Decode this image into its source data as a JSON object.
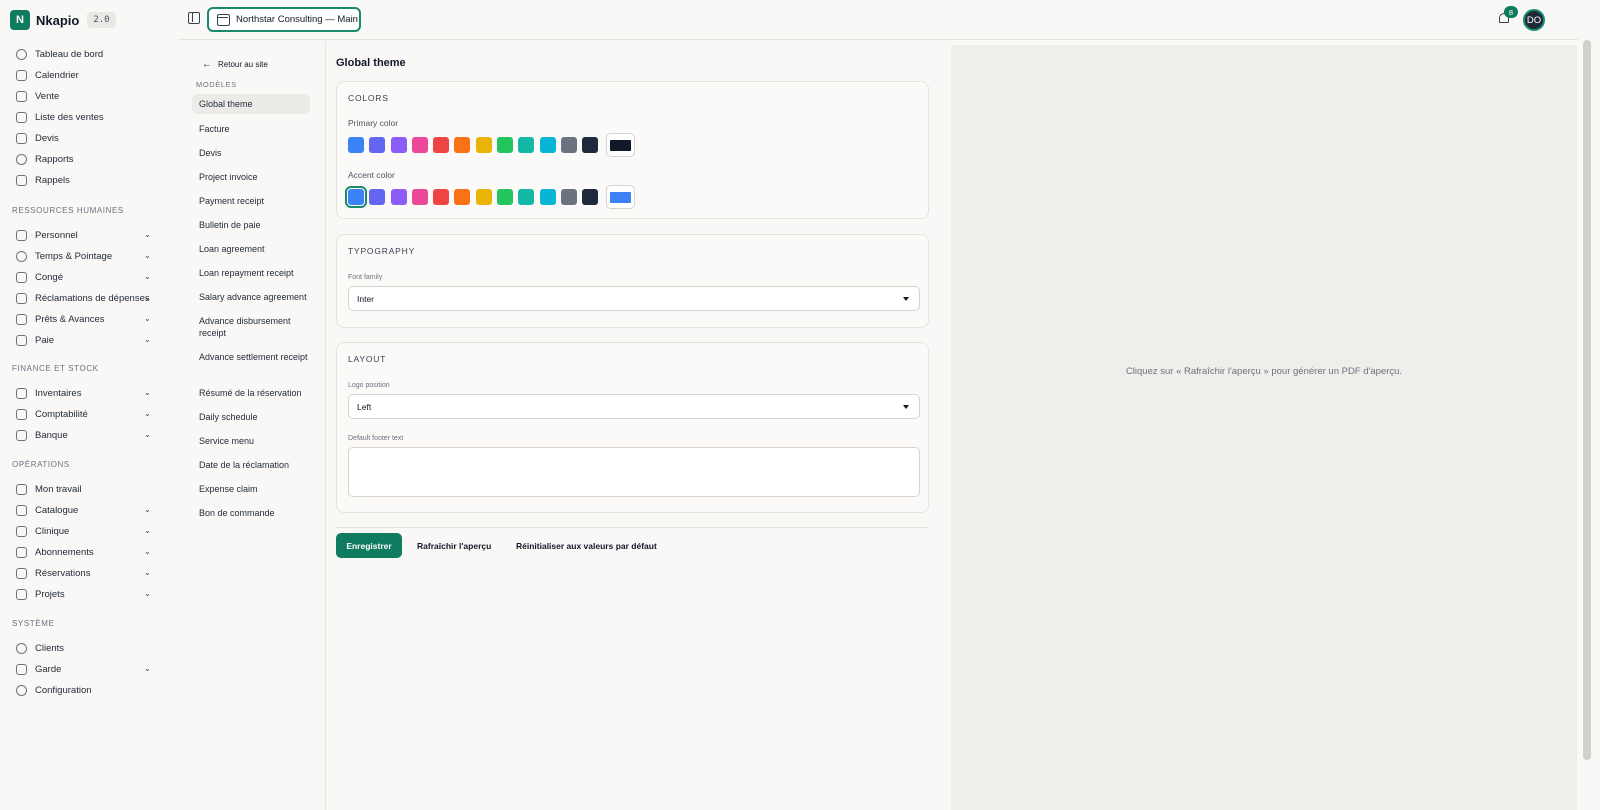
{
  "brand": {
    "initial": "N",
    "name": "Nkapio",
    "version": "2.0"
  },
  "sidebar": {
    "top_items": [
      {
        "label": "Tableau de bord",
        "icon": "dashboard-icon"
      },
      {
        "label": "Calendrier",
        "icon": "calendar-icon"
      },
      {
        "label": "Vente",
        "icon": "grid-icon"
      },
      {
        "label": "Liste des ventes",
        "icon": "cart-icon"
      },
      {
        "label": "Devis",
        "icon": "file-icon"
      },
      {
        "label": "Rapports",
        "icon": "pie-chart-icon"
      },
      {
        "label": "Rappels",
        "icon": "reminder-icon"
      }
    ],
    "sections": [
      {
        "title": "RESSOURCES HUMAINES",
        "items": [
          {
            "label": "Personnel",
            "icon": "users-icon",
            "expandable": true
          },
          {
            "label": "Temps & Pointage",
            "icon": "clock-icon",
            "expandable": true
          },
          {
            "label": "Congé",
            "icon": "leave-icon",
            "expandable": true
          },
          {
            "label": "Réclamations de dépenses",
            "icon": "receipt-icon",
            "expandable": true
          },
          {
            "label": "Prêts & Avances",
            "icon": "loan-icon",
            "expandable": true
          },
          {
            "label": "Paie",
            "icon": "payroll-icon",
            "expandable": true
          }
        ]
      },
      {
        "title": "FINANCE ET STOCK",
        "items": [
          {
            "label": "Inventaires",
            "icon": "database-icon",
            "expandable": true
          },
          {
            "label": "Comptabilité",
            "icon": "book-icon",
            "expandable": true
          },
          {
            "label": "Banque",
            "icon": "bank-icon",
            "expandable": true
          }
        ]
      },
      {
        "title": "OPÉRATIONS",
        "items": [
          {
            "label": "Mon travail",
            "icon": "wrench-icon",
            "expandable": false
          },
          {
            "label": "Catalogue",
            "icon": "catalog-icon",
            "expandable": true
          },
          {
            "label": "Clinique",
            "icon": "stethoscope-icon",
            "expandable": true
          },
          {
            "label": "Abonnements",
            "icon": "repeat-icon",
            "expandable": true
          },
          {
            "label": "Réservations",
            "icon": "calendar-check-icon",
            "expandable": true
          },
          {
            "label": "Projets",
            "icon": "briefcase-icon",
            "expandable": true
          }
        ]
      },
      {
        "title": "SYSTÈME",
        "items": [
          {
            "label": "Clients",
            "icon": "user-icon",
            "expandable": false
          },
          {
            "label": "Garde",
            "icon": "package-icon",
            "expandable": true
          },
          {
            "label": "Configuration",
            "icon": "gear-icon",
            "expandable": false
          }
        ]
      }
    ]
  },
  "topbar": {
    "workspace": "Northstar Consulting — Main",
    "notifications_count": "8",
    "avatar_initials": "DO"
  },
  "templates_nav": {
    "back_label": "Retour au site",
    "section": "MODÈLES",
    "items": [
      "Global theme",
      "Facture",
      "Devis",
      "Project invoice",
      "Payment receipt",
      "Bulletin de paie",
      "Loan agreement",
      "Loan repayment receipt",
      "Salary advance agreement",
      "Advance disbursement receipt",
      "Advance settlement receipt",
      "Résumé de la réservation",
      "Daily schedule",
      "Service menu",
      "Date de la réclamation",
      "Expense claim",
      "Bon de commande"
    ],
    "active": "Global theme"
  },
  "editor": {
    "title": "Global theme",
    "colors": {
      "section_title": "COLORS",
      "primary_label": "Primary color",
      "accent_label": "Accent color",
      "palette": [
        "#3b82f6",
        "#6366f1",
        "#8b5cf6",
        "#ec4899",
        "#ef4444",
        "#f97316",
        "#eab308",
        "#22c55e",
        "#14b8a6",
        "#06b6d4",
        "#6b7280",
        "#1e293b"
      ],
      "primary_value": "#111827",
      "accent_value": "#3b82f6"
    },
    "typography": {
      "section_title": "TYPOGRAPHY",
      "font_family_label": "Font family",
      "font_family_value": "Inter"
    },
    "layout": {
      "section_title": "LAYOUT",
      "logo_position_label": "Logo position",
      "logo_position_value": "Left",
      "footer_label": "Default footer text",
      "footer_value": ""
    },
    "actions": {
      "save": "Enregistrer",
      "refresh": "Rafraîchir l'aperçu",
      "reset": "Réinitialiser aux valeurs par défaut"
    }
  },
  "preview": {
    "message": "Cliquez sur « Rafraîchir l'aperçu » pour générer un PDF d'aperçu."
  }
}
